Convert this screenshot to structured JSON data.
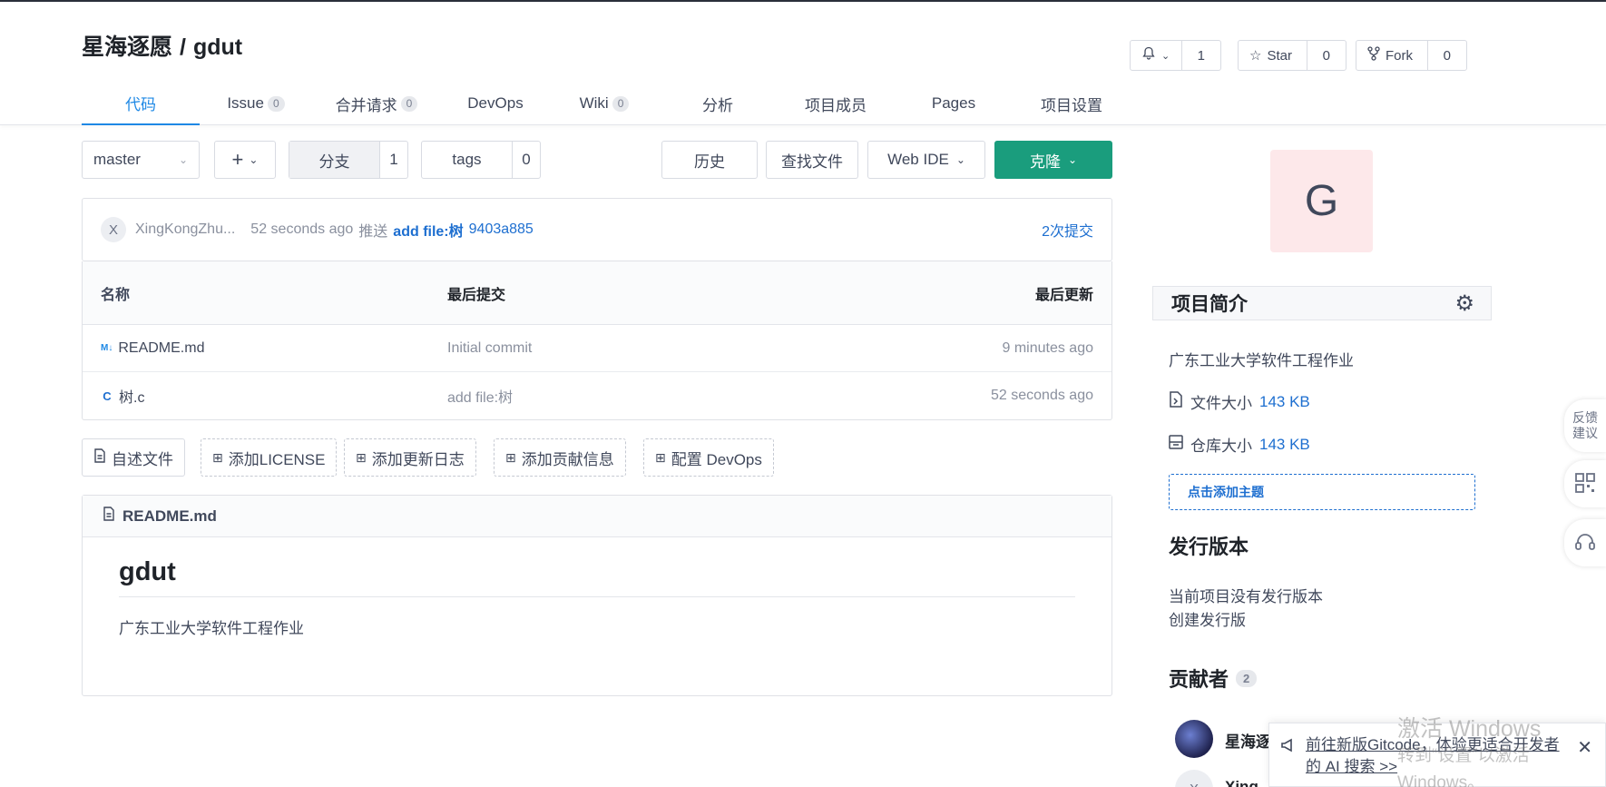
{
  "repo": {
    "owner": "星海逐愿",
    "separator": "/",
    "name": "gdut"
  },
  "actions": {
    "watch_count": "1",
    "star_label": "Star",
    "star_count": "0",
    "fork_label": "Fork",
    "fork_count": "0"
  },
  "tabs": [
    {
      "label": "代码",
      "badge": ""
    },
    {
      "label": "Issue",
      "badge": "0"
    },
    {
      "label": "合并请求",
      "badge": "0"
    },
    {
      "label": "DevOps",
      "badge": ""
    },
    {
      "label": "Wiki",
      "badge": "0"
    },
    {
      "label": "分析",
      "badge": ""
    },
    {
      "label": "项目成员",
      "badge": ""
    },
    {
      "label": "Pages",
      "badge": ""
    },
    {
      "label": "项目设置",
      "badge": ""
    }
  ],
  "toolbar": {
    "branch": "master",
    "add_label": "+",
    "branches_label": "分支",
    "branches_count": "1",
    "tags_label": "tags",
    "tags_count": "0",
    "history_label": "历史",
    "find_file_label": "查找文件",
    "web_ide_label": "Web IDE",
    "clone_label": "克隆"
  },
  "commit": {
    "avatar_letter": "X",
    "author": "XingKongZhu...",
    "time": "52 seconds ago",
    "action": "推送",
    "message": "add file:树",
    "sha": "9403a885",
    "count_label": "2次提交"
  },
  "file_table": {
    "headers": {
      "name": "名称",
      "commit": "最后提交",
      "time": "最后更新"
    },
    "rows": [
      {
        "icon": "M↓",
        "name": "README.md",
        "commit": "Initial commit",
        "time": "9 minutes ago"
      },
      {
        "icon": "C",
        "name": "树.c",
        "commit": "add file:树",
        "time": "52 seconds ago"
      }
    ]
  },
  "file_actions": {
    "readme": "自述文件",
    "license": "添加LICENSE",
    "changelog": "添加更新日志",
    "contrib": "添加贡献信息",
    "devops": "配置 DevOps"
  },
  "readme": {
    "filename": "README.md",
    "heading": "gdut",
    "body": "广东工业大学软件工程作业"
  },
  "sidebar": {
    "avatar_letter": "G",
    "intro_title": "项目简介",
    "description": "广东工业大学软件工程作业",
    "file_size_label": "文件大小",
    "file_size": "143 KB",
    "repo_size_label": "仓库大小",
    "repo_size": "143 KB",
    "add_topic": "点击添加主题",
    "releases_title": "发行版本",
    "no_release": "当前项目没有发行版本",
    "create_release": "创建发行版",
    "contributors_title": "贡献者",
    "contributors_count": "2",
    "contributor1": "星海逐",
    "contributor2_avatar": "X",
    "contributor2": "Xing"
  },
  "float": {
    "feedback_line1": "反馈",
    "feedback_line2": "建议"
  },
  "notice": {
    "text": "前往新版Gitcode，体验更适合开发者的 AI 搜索 >>"
  },
  "watermark": {
    "line1": "激活 Windows",
    "line2": "转到“设置”以激活 Windows。"
  },
  "colors": {
    "accent": "#1e88e5",
    "primary": "#1a9d7d",
    "link": "#1e6fd0"
  }
}
